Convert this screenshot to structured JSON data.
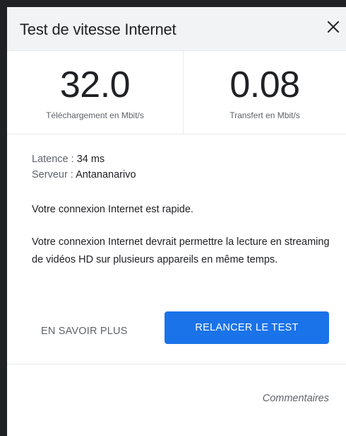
{
  "dialog": {
    "title": "Test de vitesse Internet",
    "close_icon": "close-icon"
  },
  "metrics": {
    "download": {
      "value": "32.0",
      "unit": "Téléchargement en Mbit/s"
    },
    "upload": {
      "value": "0.08",
      "unit": "Transfert en Mbit/s"
    }
  },
  "info": {
    "latency_label": "Latence : ",
    "latency_value": "34 ms",
    "server_label": "Serveur : ",
    "server_value": "Antananarivo"
  },
  "messages": {
    "speed": "Votre connexion Internet est rapide.",
    "capability": "Votre connexion Internet devrait permettre la lecture en streaming de vidéos HD sur plusieurs appareils en même temps."
  },
  "actions": {
    "learn_more": "EN SAVOIR PLUS",
    "rerun": "RELANCER LE TEST"
  },
  "footer": {
    "feedback": "Commentaires"
  },
  "colors": {
    "accent": "#1a73e8",
    "header_bg": "#f1f3f4",
    "backdrop": "#202124"
  }
}
